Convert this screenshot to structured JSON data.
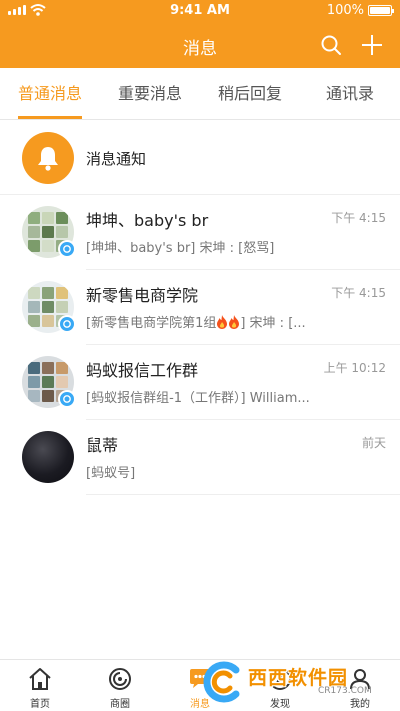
{
  "status_bar": {
    "time": "9:41 AM",
    "battery": "100%"
  },
  "header": {
    "title": "消息"
  },
  "tabs": [
    {
      "label": "普通消息",
      "active": true
    },
    {
      "label": "重要消息",
      "active": false
    },
    {
      "label": "稍后回复",
      "active": false
    },
    {
      "label": "通讯录",
      "active": false
    }
  ],
  "notice": {
    "label": "消息通知",
    "icon": "bell-icon"
  },
  "conversations": [
    {
      "name": "坤坤、baby's br",
      "time": "下午 4:15",
      "preview": "[坤坤、baby's br] 宋坤 : [怒骂]",
      "group": true
    },
    {
      "name": "新零售电商学院",
      "time": "下午 4:15",
      "preview_before": "[新零售电商学院第1组",
      "preview_after": "] 宋坤 : [...",
      "group": true
    },
    {
      "name": "蚂蚁报信工作群",
      "time": "上午 10:12",
      "preview": "[蚂蚁报信群组-1（工作群）] William...",
      "group": true
    },
    {
      "name": "鼠蒂",
      "time": "前天",
      "preview": "[蚂蚁号]",
      "group": false
    }
  ],
  "bottom_nav": [
    {
      "label": "首页",
      "icon": "home-icon",
      "active": false
    },
    {
      "label": "商圈",
      "icon": "circle-icon",
      "active": false
    },
    {
      "label": "消息",
      "icon": "message-icon",
      "active": true
    },
    {
      "label": "发现",
      "icon": "discover-icon",
      "active": false
    },
    {
      "label": "我的",
      "icon": "profile-icon",
      "active": false
    }
  ],
  "watermark": {
    "text": "西西软件园",
    "sub": "CR173.COM"
  },
  "colors": {
    "accent": "#f69a1f",
    "badge": "#39a9f5"
  }
}
